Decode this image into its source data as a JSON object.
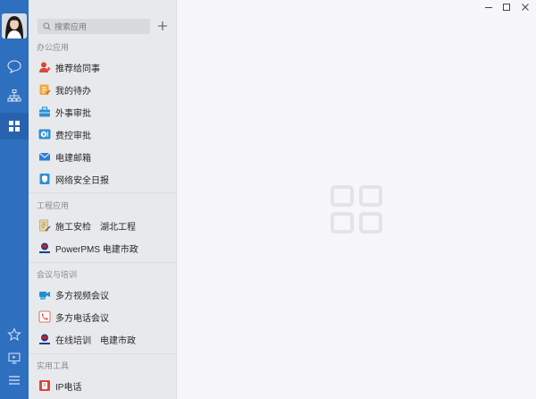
{
  "search": {
    "placeholder": "搜索应用"
  },
  "sections": [
    {
      "title": "办公应用",
      "items": [
        {
          "label": "推荐给同事",
          "icon": "recommend-icon",
          "color": "#d9473a"
        },
        {
          "label": "我的待办",
          "icon": "todo-icon",
          "color": "#e89c2b"
        },
        {
          "label": "外事审批",
          "icon": "briefcase-icon",
          "color": "#2d8fd5"
        },
        {
          "label": "费控审批",
          "icon": "expense-icon",
          "color": "#2d8fd5"
        },
        {
          "label": "电建邮箱",
          "icon": "mail-icon",
          "color": "#2d7fd5"
        },
        {
          "label": "网络安全日报",
          "icon": "shield-icon",
          "color": "#2d8fd5"
        }
      ]
    },
    {
      "title": "工程应用",
      "items": [
        {
          "label": "施工安检　湖北工程",
          "icon": "inspection-icon",
          "color": "#c9a24a"
        },
        {
          "label": "PowerPMS 电建市政",
          "icon": "powerchina-logo-icon",
          "color": "#c8202a"
        }
      ]
    },
    {
      "title": "会议与培训",
      "items": [
        {
          "label": "多方视频会议",
          "icon": "video-conference-icon",
          "color": "#1e8fd6"
        },
        {
          "label": "多方电话会议",
          "icon": "phone-conference-icon",
          "color": "#d9473a"
        },
        {
          "label": "在线培训　电建市政",
          "icon": "powerchina-logo-icon",
          "color": "#c8202a"
        }
      ]
    },
    {
      "title": "实用工具",
      "items": [
        {
          "label": "IP电话",
          "icon": "ip-phone-icon",
          "color": "#d9473a"
        }
      ]
    }
  ],
  "rail": {
    "color": "#2f6fc0",
    "icons": [
      "chat-icon",
      "org-chart-icon",
      "apps-grid-icon",
      "star-icon",
      "screen-icon",
      "menu-icon"
    ]
  }
}
